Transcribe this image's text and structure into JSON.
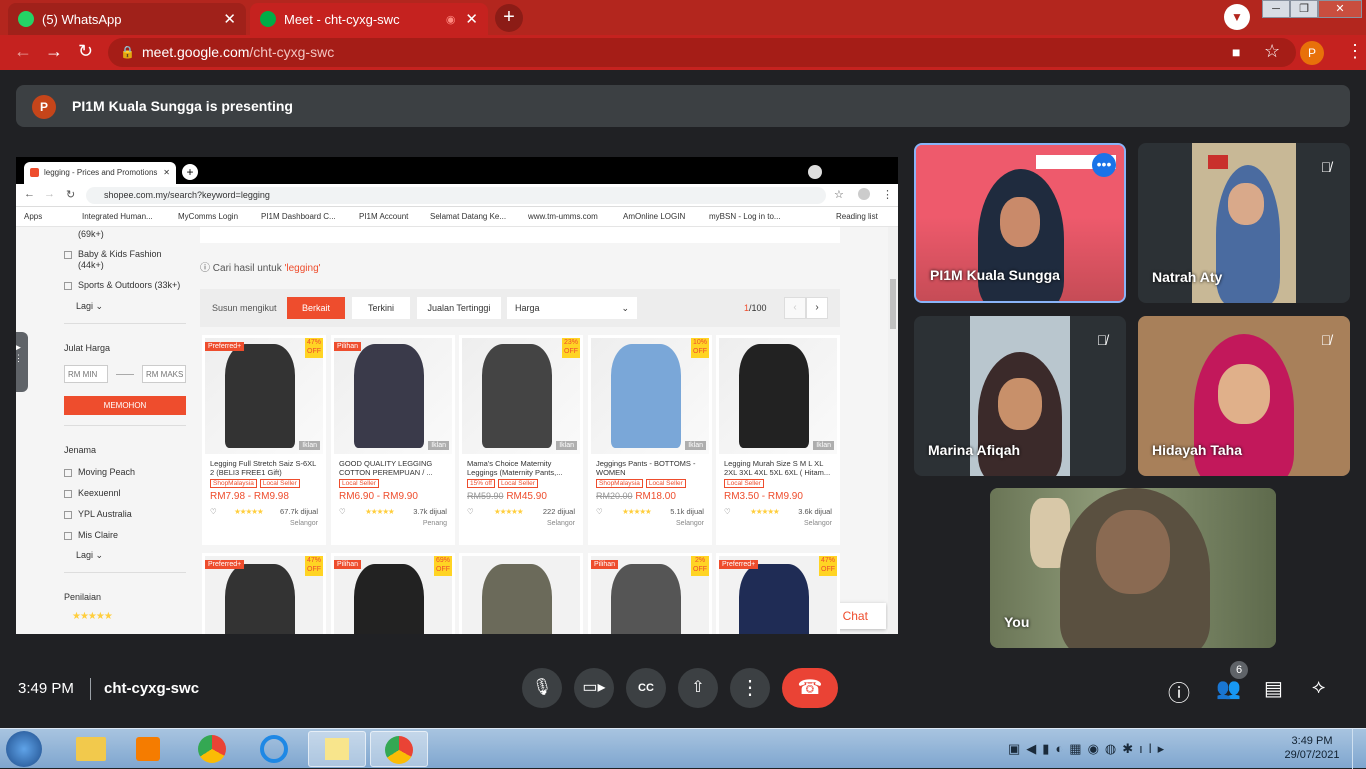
{
  "browser": {
    "tabs": [
      {
        "title": "(5) WhatsApp",
        "favicon_color": "#25d366"
      },
      {
        "title": "Meet - cht-cyxg-swc",
        "favicon_color": "#00ac47"
      }
    ],
    "url_host": "meet.google.com",
    "url_path": "/cht-cyxg-swc",
    "profile_initial": "P"
  },
  "meet": {
    "presenter_initial": "P",
    "presenting_text": "PI1M Kuala Sungga is presenting",
    "time": "3:49 PM",
    "meeting_code": "cht-cyxg-swc",
    "participant_count": "6",
    "participants": [
      {
        "name": "PI1M Kuala Sungga"
      },
      {
        "name": "Natrah Aty"
      },
      {
        "name": "Marina Afiqah"
      },
      {
        "name": "Hidayah Taha"
      },
      {
        "name": "You"
      }
    ]
  },
  "shared": {
    "tab_title": "legging - Prices and Promotions",
    "url": "shopee.com.my/search?keyword=legging",
    "bookmarks": [
      "Apps",
      "Integrated Human...",
      "MyComms Login",
      "PI1M Dashboard C...",
      "PI1M Account",
      "Selamat Datang Ke...",
      "www.tm-umms.com",
      "AmOnline LOGIN",
      "myBSN - Log in to...",
      "Reading list"
    ],
    "sidebar": {
      "count_top": "(69k+)",
      "cat1": "Baby & Kids Fashion",
      "cat1_count": "(44k+)",
      "cat2": "Sports & Outdoors (33k+)",
      "more": "Lagi",
      "price_title": "Julat Harga",
      "min_placeholder": "RM MIN",
      "max_placeholder": "RM MAKS",
      "apply": "MEMOHON",
      "brand_title": "Jenama",
      "brands": [
        "Moving Peach",
        "Keexuennl",
        "YPL Australia",
        "Mis Claire"
      ],
      "more2": "Lagi",
      "rating_title": "Penilaian"
    },
    "search_hint_prefix": "Cari hasil untuk ",
    "search_hint_term": "'legging'",
    "sort_label": "Susun mengikut",
    "sort_options": [
      "Berkait",
      "Terkini",
      "Jualan Tertinggi",
      "Harga"
    ],
    "page": "1",
    "page_total": "/100",
    "products": [
      {
        "name": "Legging Full Stretch Saiz S-6XL 2 (BELI3 FREE1 Gift)",
        "tags": [
          "ShopMalaysia",
          "Local Seller"
        ],
        "price": "RM7.98 - RM9.98",
        "old": "",
        "sold": "67.7k dijual",
        "loc": "Selangor",
        "badge": "Preferred+",
        "off": "47% OFF",
        "img_color": "#333"
      },
      {
        "name": "GOOD QUALITY LEGGING COTTON PEREMPUAN / ...",
        "tags": [
          "Local Seller"
        ],
        "price": "RM6.90 - RM9.90",
        "old": "",
        "sold": "3.7k dijual",
        "loc": "Penang",
        "badge": "Pilihan",
        "off": "",
        "img_color": "#3a3a4a"
      },
      {
        "name": "Mama's Choice Maternity Leggings (Maternity Pants,...",
        "tags": [
          "15% off",
          "Local Seller"
        ],
        "price": "RM45.90",
        "old": "RM59.90",
        "sold": "222 dijual",
        "loc": "Selangor",
        "badge": "",
        "off": "23% OFF",
        "img_color": "#444"
      },
      {
        "name": "Jeggings Pants - BOTTOMS - WOMEN",
        "tags": [
          "ShopMalaysia",
          "Local Seller"
        ],
        "price": "RM18.00",
        "old": "RM20.00",
        "sold": "5.1k dijual",
        "loc": "Selangor",
        "badge": "",
        "off": "10% OFF",
        "img_color": "#7aa7d8"
      },
      {
        "name": "Legging Murah Size S M L XL 2XL 3XL 4XL 5XL 6XL ( Hitam...",
        "tags": [
          "Local Seller"
        ],
        "price": "RM3.50 - RM9.90",
        "old": "",
        "sold": "3.6k dijual",
        "loc": "Selangor",
        "badge": "",
        "off": "",
        "img_color": "#222"
      }
    ],
    "row2_badges": [
      "Preferred+",
      "Pilihan",
      "",
      "Pilihan",
      "Preferred+"
    ],
    "row2_off": [
      "47% OFF",
      "69% OFF",
      "",
      "2% OFF",
      "47% OFF"
    ],
    "ad_label": "Iklan",
    "chat_label": "Chat"
  },
  "taskbar": {
    "clock_time": "3:49 PM",
    "clock_date": "29/07/2021"
  }
}
